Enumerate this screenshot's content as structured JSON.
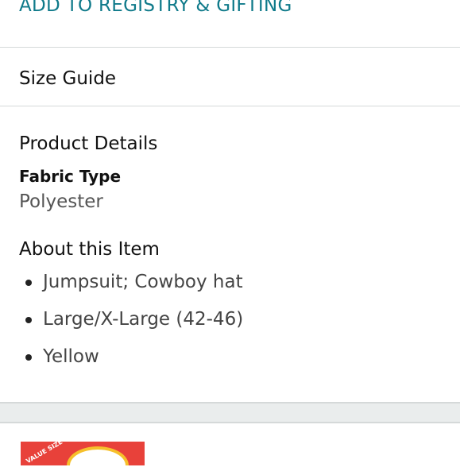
{
  "header": {
    "registry_label": "ADD TO REGISTRY & GIFTING"
  },
  "size_guide": {
    "label": "Size Guide"
  },
  "product_details": {
    "title": "Product Details",
    "fabric_type_label": "Fabric Type",
    "fabric_type_value": "Polyester"
  },
  "about": {
    "title": "About this Item",
    "bullets": [
      "Jumpsuit; Cowboy hat",
      "Large/X-Large (42-46)",
      "Yellow"
    ]
  },
  "thumbnail": {
    "badge_text": "VALUE SIZE"
  },
  "colors": {
    "link": "#0f7a8a",
    "divider": "#d5d9d9",
    "muted_text": "#555555"
  }
}
